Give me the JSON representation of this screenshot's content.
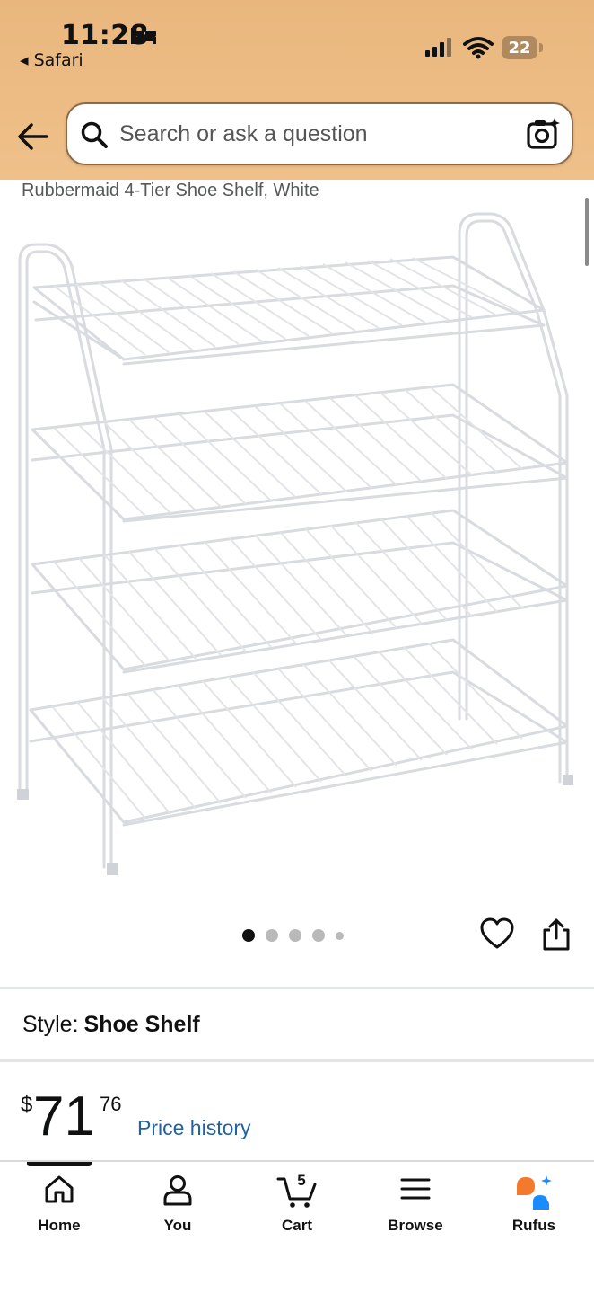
{
  "status_bar": {
    "time": "11:28",
    "back_app": "◂ Safari",
    "battery": "22"
  },
  "search": {
    "placeholder": "Search or ask a question"
  },
  "product": {
    "title": "Rubbermaid 4-Tier Shoe Shelf, White",
    "image_alt": "white 4-tier wire shoe shelf",
    "image_count": 5,
    "active_image": 1
  },
  "style": {
    "label": "Style:",
    "value": "Shoe Shelf"
  },
  "price": {
    "symbol": "$",
    "whole": "71",
    "fraction": "76",
    "history_link": "Price history"
  },
  "tabs": [
    {
      "label": "Home",
      "icon": "home-icon"
    },
    {
      "label": "You",
      "icon": "person-icon"
    },
    {
      "label": "Cart",
      "icon": "cart-icon",
      "count": "5"
    },
    {
      "label": "Browse",
      "icon": "menu-icon"
    },
    {
      "label": "Rufus",
      "icon": "rufus-icon"
    }
  ],
  "colors": {
    "header": "#efc089",
    "link": "#2162a1",
    "rufus_orange": "#f5792a",
    "rufus_blue": "#1a8cff"
  }
}
